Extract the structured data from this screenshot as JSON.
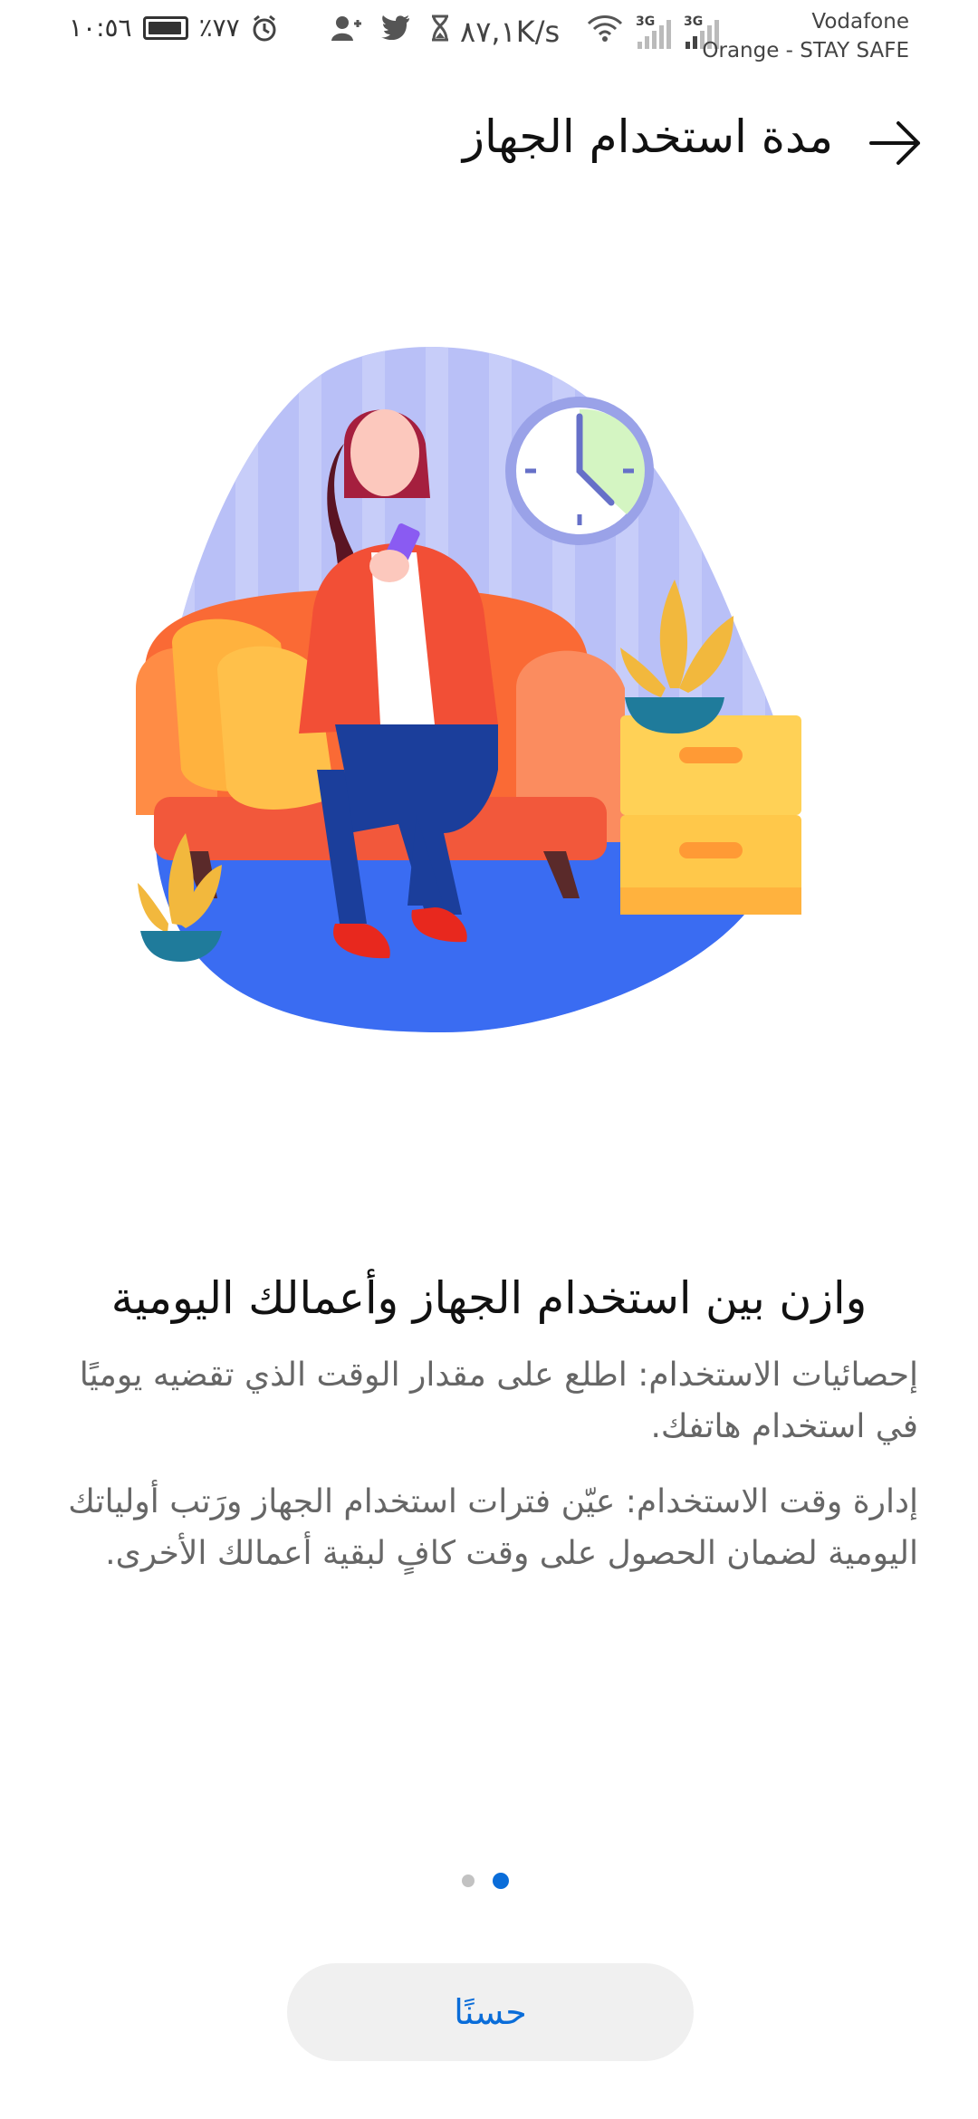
{
  "status_bar": {
    "time": "١٠:٥٦",
    "battery": "٪٧٧",
    "speed": "٨٧,١K/s",
    "net1": "3G",
    "net2": "3G",
    "carrier1": "Vodafone",
    "carrier2": "Orange - STAY SAFE",
    "icons": [
      "alarm-icon",
      "add-user-icon",
      "twitter-icon",
      "hourglass-icon",
      "wifi-icon",
      "signal-icon"
    ]
  },
  "header": {
    "title": "مدة استخدام الجهاز",
    "back_icon": "arrow-icon"
  },
  "content": {
    "heading": "وازن بين استخدام الجهاز وأعمالك اليومية",
    "paragraph1": "إحصائيات الاستخدام: اطلع على مقدار الوقت الذي تقضيه يوميًا في استخدام هاتفك.",
    "paragraph2": "إدارة وقت الاستخدام: عيّن فترات استخدام الجهاز ورَتب أولياتك اليومية لضمان الحصول على وقت كافٍ لبقية أعمالك الأخرى."
  },
  "pager": {
    "total": 2,
    "active": 2
  },
  "ok_button": {
    "label": "حسنًا"
  },
  "colors": {
    "accent": "#0a6dd9",
    "button_bg": "#f0f0f0",
    "body_text": "#666666"
  }
}
